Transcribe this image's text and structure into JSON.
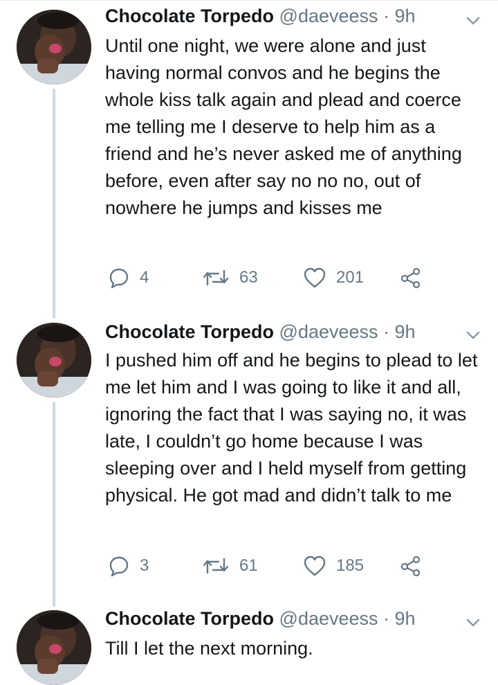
{
  "tweets": [
    {
      "name": "Chocolate Torpedo",
      "handle": "@daeveess",
      "time": "· 9h",
      "text": "Until one night, we were alone and just having normal convos and he begins the whole kiss talk again and plead and coerce me telling me I deserve to help him as a friend and he’s never asked me of anything before, even after say no no no, out of nowhere he jumps and kisses me",
      "replies": "4",
      "retweets": "63",
      "likes": "201"
    },
    {
      "name": "Chocolate Torpedo",
      "handle": "@daeveess",
      "time": "· 9h",
      "text": "I pushed him off and he begins to plead to let me let him and I was going to like it and all, ignoring the fact that I was saying no, it was late, I couldn’t go home because I was sleeping over and I held myself from getting physical. He got mad and didn’t talk to me",
      "replies": "3",
      "retweets": "61",
      "likes": "185"
    },
    {
      "name": "Chocolate Torpedo",
      "handle": "@daeveess",
      "time": "· 9h",
      "text": "Till I let the next morning."
    }
  ],
  "icons": {
    "reply": "reply-icon",
    "retweet": "retweet-icon",
    "like": "heart-icon",
    "share": "share-icon",
    "menu": "chevron-down-icon"
  },
  "colors": {
    "text": "#14171a",
    "secondary": "#657786",
    "thread_line": "#cfd9de"
  }
}
